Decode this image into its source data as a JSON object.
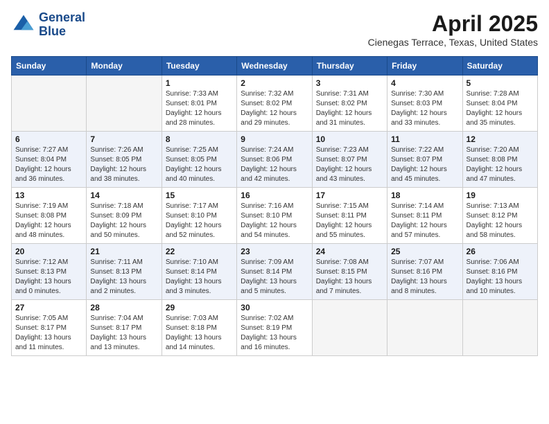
{
  "header": {
    "logo_line1": "General",
    "logo_line2": "Blue",
    "month_title": "April 2025",
    "location": "Cienegas Terrace, Texas, United States"
  },
  "weekdays": [
    "Sunday",
    "Monday",
    "Tuesday",
    "Wednesday",
    "Thursday",
    "Friday",
    "Saturday"
  ],
  "weeks": [
    [
      {
        "num": "",
        "sunrise": "",
        "sunset": "",
        "daylight": "",
        "empty": true
      },
      {
        "num": "",
        "sunrise": "",
        "sunset": "",
        "daylight": "",
        "empty": true
      },
      {
        "num": "1",
        "sunrise": "7:33 AM",
        "sunset": "8:01 PM",
        "daylight": "12 hours and 28 minutes.",
        "empty": false
      },
      {
        "num": "2",
        "sunrise": "7:32 AM",
        "sunset": "8:02 PM",
        "daylight": "12 hours and 29 minutes.",
        "empty": false
      },
      {
        "num": "3",
        "sunrise": "7:31 AM",
        "sunset": "8:02 PM",
        "daylight": "12 hours and 31 minutes.",
        "empty": false
      },
      {
        "num": "4",
        "sunrise": "7:30 AM",
        "sunset": "8:03 PM",
        "daylight": "12 hours and 33 minutes.",
        "empty": false
      },
      {
        "num": "5",
        "sunrise": "7:28 AM",
        "sunset": "8:04 PM",
        "daylight": "12 hours and 35 minutes.",
        "empty": false
      }
    ],
    [
      {
        "num": "6",
        "sunrise": "7:27 AM",
        "sunset": "8:04 PM",
        "daylight": "12 hours and 36 minutes.",
        "empty": false
      },
      {
        "num": "7",
        "sunrise": "7:26 AM",
        "sunset": "8:05 PM",
        "daylight": "12 hours and 38 minutes.",
        "empty": false
      },
      {
        "num": "8",
        "sunrise": "7:25 AM",
        "sunset": "8:05 PM",
        "daylight": "12 hours and 40 minutes.",
        "empty": false
      },
      {
        "num": "9",
        "sunrise": "7:24 AM",
        "sunset": "8:06 PM",
        "daylight": "12 hours and 42 minutes.",
        "empty": false
      },
      {
        "num": "10",
        "sunrise": "7:23 AM",
        "sunset": "8:07 PM",
        "daylight": "12 hours and 43 minutes.",
        "empty": false
      },
      {
        "num": "11",
        "sunrise": "7:22 AM",
        "sunset": "8:07 PM",
        "daylight": "12 hours and 45 minutes.",
        "empty": false
      },
      {
        "num": "12",
        "sunrise": "7:20 AM",
        "sunset": "8:08 PM",
        "daylight": "12 hours and 47 minutes.",
        "empty": false
      }
    ],
    [
      {
        "num": "13",
        "sunrise": "7:19 AM",
        "sunset": "8:08 PM",
        "daylight": "12 hours and 48 minutes.",
        "empty": false
      },
      {
        "num": "14",
        "sunrise": "7:18 AM",
        "sunset": "8:09 PM",
        "daylight": "12 hours and 50 minutes.",
        "empty": false
      },
      {
        "num": "15",
        "sunrise": "7:17 AM",
        "sunset": "8:10 PM",
        "daylight": "12 hours and 52 minutes.",
        "empty": false
      },
      {
        "num": "16",
        "sunrise": "7:16 AM",
        "sunset": "8:10 PM",
        "daylight": "12 hours and 54 minutes.",
        "empty": false
      },
      {
        "num": "17",
        "sunrise": "7:15 AM",
        "sunset": "8:11 PM",
        "daylight": "12 hours and 55 minutes.",
        "empty": false
      },
      {
        "num": "18",
        "sunrise": "7:14 AM",
        "sunset": "8:11 PM",
        "daylight": "12 hours and 57 minutes.",
        "empty": false
      },
      {
        "num": "19",
        "sunrise": "7:13 AM",
        "sunset": "8:12 PM",
        "daylight": "12 hours and 58 minutes.",
        "empty": false
      }
    ],
    [
      {
        "num": "20",
        "sunrise": "7:12 AM",
        "sunset": "8:13 PM",
        "daylight": "13 hours and 0 minutes.",
        "empty": false
      },
      {
        "num": "21",
        "sunrise": "7:11 AM",
        "sunset": "8:13 PM",
        "daylight": "13 hours and 2 minutes.",
        "empty": false
      },
      {
        "num": "22",
        "sunrise": "7:10 AM",
        "sunset": "8:14 PM",
        "daylight": "13 hours and 3 minutes.",
        "empty": false
      },
      {
        "num": "23",
        "sunrise": "7:09 AM",
        "sunset": "8:14 PM",
        "daylight": "13 hours and 5 minutes.",
        "empty": false
      },
      {
        "num": "24",
        "sunrise": "7:08 AM",
        "sunset": "8:15 PM",
        "daylight": "13 hours and 7 minutes.",
        "empty": false
      },
      {
        "num": "25",
        "sunrise": "7:07 AM",
        "sunset": "8:16 PM",
        "daylight": "13 hours and 8 minutes.",
        "empty": false
      },
      {
        "num": "26",
        "sunrise": "7:06 AM",
        "sunset": "8:16 PM",
        "daylight": "13 hours and 10 minutes.",
        "empty": false
      }
    ],
    [
      {
        "num": "27",
        "sunrise": "7:05 AM",
        "sunset": "8:17 PM",
        "daylight": "13 hours and 11 minutes.",
        "empty": false
      },
      {
        "num": "28",
        "sunrise": "7:04 AM",
        "sunset": "8:17 PM",
        "daylight": "13 hours and 13 minutes.",
        "empty": false
      },
      {
        "num": "29",
        "sunrise": "7:03 AM",
        "sunset": "8:18 PM",
        "daylight": "13 hours and 14 minutes.",
        "empty": false
      },
      {
        "num": "30",
        "sunrise": "7:02 AM",
        "sunset": "8:19 PM",
        "daylight": "13 hours and 16 minutes.",
        "empty": false
      },
      {
        "num": "",
        "sunrise": "",
        "sunset": "",
        "daylight": "",
        "empty": true
      },
      {
        "num": "",
        "sunrise": "",
        "sunset": "",
        "daylight": "",
        "empty": true
      },
      {
        "num": "",
        "sunrise": "",
        "sunset": "",
        "daylight": "",
        "empty": true
      }
    ]
  ],
  "labels": {
    "sunrise_prefix": "Sunrise: ",
    "sunset_prefix": "Sunset: ",
    "daylight_prefix": "Daylight: "
  }
}
